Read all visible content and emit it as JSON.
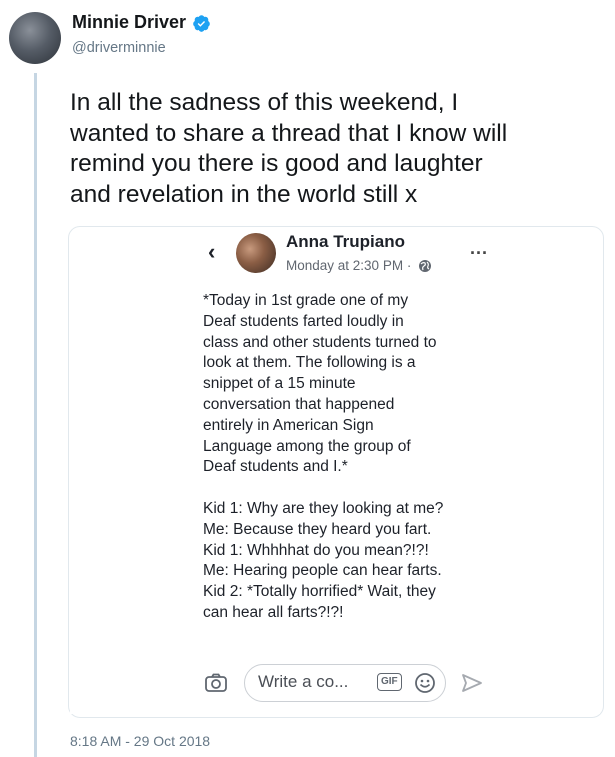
{
  "tweet": {
    "author": {
      "name": "Minnie Driver",
      "handle": "@driverminnie",
      "verified": true
    },
    "text": "In all the sadness of this weekend, I\nwanted to share a thread that I know will\nremind you there is good and laughter\nand revelation in the world still x",
    "timestamp": "8:18 AM - 29 Oct 2018"
  },
  "embedded_post": {
    "back_icon": "chevron-left-icon",
    "author_name": "Anna Trupiano",
    "meta": "Monday at 2:30 PM ·",
    "privacy_icon": "globe-icon",
    "more_label": "...",
    "body": "*Today in 1st grade one of my\nDeaf students farted loudly in\nclass and other students turned to\nlook at them. The following is a\nsnippet of a 15 minute\nconversation that happened\nentirely in American Sign\nLanguage among the group of\nDeaf students and I.*\n\nKid 1: Why are they looking at me?\nMe: Because they heard you fart.\nKid 1: Whhhhat do you mean?!?!\nMe: Hearing people can hear farts.\nKid 2: *Totally horrified* Wait, they\ncan hear all farts?!?!",
    "composer": {
      "placeholder": "Write a co...",
      "gif_label": "GIF",
      "icons": [
        "camera-icon",
        "gif-icon",
        "emoji-icon",
        "send-icon"
      ]
    }
  },
  "colors": {
    "thread_line": "#c6d6e3",
    "verified": "#1da1f2",
    "secondary_text": "#657786"
  }
}
